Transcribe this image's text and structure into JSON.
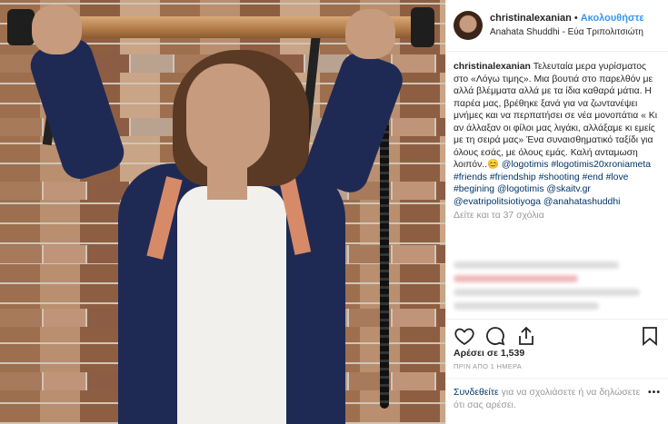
{
  "header": {
    "username": "christinalexanian",
    "dot": "•",
    "follow_label": "Ακολουθήστε",
    "location": "Anahata Shuddhi - Εύα Τριπολιτσιώτη"
  },
  "caption": {
    "username": "christinalexanian",
    "text": "Τελευταία μερα γυρίσματος στο «Λόγω τιμης». Μια βουτιά στο παρελθόν με αλλά βλέμματα αλλά με τα ίδια καθαρά μάτια. Η παρέα μας, βρέθηκε ξανά για να ζωντανέψει μνήμες και να περπατήσει σε νέα μονοπάτια « Κι αν άλλαξαν οι φίλοι μας λιγάκι, αλλάξαμε κι εμείς με τη σειρά μας» Ένα συναισθηματικό ταξίδι για όλους εσάς, με όλους εμάς. Καλή ανταμωση λοιπόν..",
    "emoji": "😊",
    "tags": [
      "@logotimis",
      "#logotimis20xroniameta",
      "#friends",
      "#friendship",
      "#shooting",
      "#end",
      "#love",
      "#begining",
      "@logotimis",
      "@skaitv.gr",
      "@evatripolitsiotiyoga",
      "@anahatashuddhi"
    ],
    "more_comments": "Δείτε και τα 37 σχόλια"
  },
  "actions": {
    "like_icon": "heart-icon",
    "comment_icon": "comment-icon",
    "share_icon": "share-icon",
    "save_icon": "bookmark-icon"
  },
  "likes": "Αρέσει σε 1,539",
  "time": "ΠΡΙΝ ΑΠΟ 1 ΗΜΕΡΑ",
  "comment_box": {
    "login": "Συνδεθείτε",
    "rest": " για να σχολιάσετε ή να δηλώσετε ότι σας αρέσει.",
    "more": "•••"
  }
}
